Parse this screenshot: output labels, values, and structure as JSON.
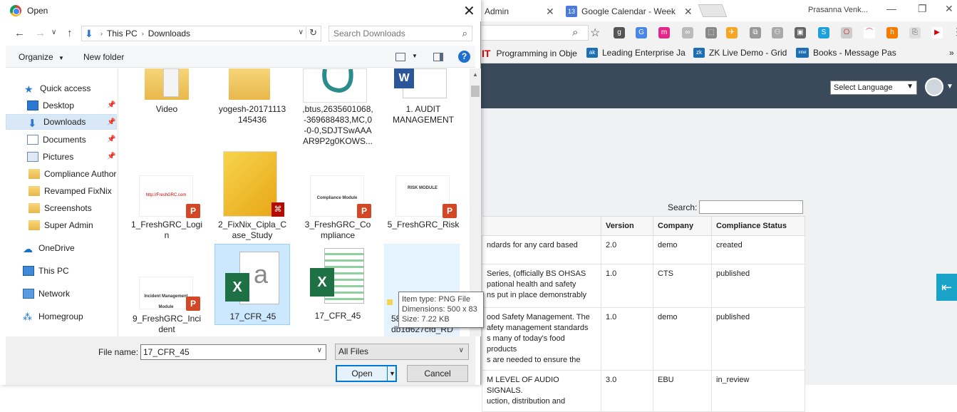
{
  "browser": {
    "tabs": [
      {
        "label": "Admin"
      },
      {
        "label": "Google Calendar - Week",
        "favicon_text": "13"
      }
    ],
    "profile_name": "Prasanna Venk...",
    "bookmarks": [
      {
        "label": "Programming in Obje",
        "prefix": "IT"
      },
      {
        "label": "Leading Enterprise Ja",
        "icon_text": "ak"
      },
      {
        "label": "ZK Live Demo - Grid",
        "icon_text": "zk"
      },
      {
        "label": "Books - Message Pas",
        "icon_text": "intel"
      }
    ],
    "language_select": "Select Language",
    "search_label": "Search:",
    "table": {
      "headers": [
        "Version",
        "Company",
        "Compliance Status"
      ],
      "rows": [
        {
          "desc": "ndards for any card based",
          "version": "2.0",
          "company": "demo",
          "status": "created"
        },
        {
          "desc": "Series, (officially BS OHSAS\npational health and safety\nns put in place demonstrably",
          "version": "1.0",
          "company": "CTS",
          "status": "published"
        },
        {
          "desc": "ood Safety Management. The\nafety management standards\ns many of today's food products\ns are needed to ensure the",
          "version": "1.0",
          "company": "demo",
          "status": "published"
        },
        {
          "desc": "M LEVEL OF AUDIO SIGNALS.\nuction, distribution and",
          "version": "3.0",
          "company": "EBU",
          "status": "in_review"
        }
      ]
    }
  },
  "dialog": {
    "title": "Open",
    "breadcrumb": [
      "This PC",
      "Downloads"
    ],
    "search_placeholder": "Search Downloads",
    "toolbar": {
      "organize": "Organize",
      "new_folder": "New folder",
      "help": "?"
    },
    "nav": [
      {
        "label": "Quick access",
        "icon": "star-icon"
      },
      {
        "label": "Desktop",
        "icon": "desktop-icon",
        "pinned": true
      },
      {
        "label": "Downloads",
        "icon": "download-icon",
        "pinned": true,
        "selected": true
      },
      {
        "label": "Documents",
        "icon": "documents-icon",
        "pinned": true
      },
      {
        "label": "Pictures",
        "icon": "pictures-icon",
        "pinned": true
      },
      {
        "label": "Compliance Author",
        "icon": "folder-icon"
      },
      {
        "label": "Revamped FixNix",
        "icon": "folder-icon"
      },
      {
        "label": "Screenshots",
        "icon": "folder-icon"
      },
      {
        "label": "Super Admin",
        "icon": "folder-icon"
      },
      {
        "label": "OneDrive",
        "icon": "cloud-icon"
      },
      {
        "label": "This PC",
        "icon": "computer-icon"
      },
      {
        "label": "Network",
        "icon": "network-icon"
      },
      {
        "label": "Homegroup",
        "icon": "homegroup-icon"
      }
    ],
    "files": [
      {
        "name": "Video"
      },
      {
        "name": "yogesh-20171113\n145436"
      },
      {
        "name": ",btus,2635601068,\n-369688483,MC,0\n-0-0,SDJTSwAAA\nAR9P2g0KOWS..."
      },
      {
        "name": "1. AUDIT\nMANAGEMENT",
        "badge": "W"
      },
      {
        "name": "1_FreshGRC_Logi\nn",
        "slide_text": "http://FreshGRC.com",
        "badge": "P"
      },
      {
        "name": "2_FixNix_Cipla_C\nase_Study",
        "badge": "PDF"
      },
      {
        "name": "3_FreshGRC_Co\nmpliance",
        "slide_text": "Compliance Module",
        "badge": "P"
      },
      {
        "name": "5_FreshGRC_Risk",
        "slide_text": "RISK MODULE",
        "badge": "P"
      },
      {
        "name": "9_FreshGRC_Inci\ndent",
        "slide_text": "Incident Management Module",
        "badge": "P"
      },
      {
        "name": "17_CFR_45",
        "badge": "X",
        "selected": true
      },
      {
        "name": "17_CFR_45",
        "badge": "X"
      },
      {
        "name": "58...\ndb1d627cfd_RD",
        "hover": true
      }
    ],
    "tooltip": {
      "line1": "Item type: PNG File",
      "line2": "Dimensions: 500 x 83",
      "line3": "Size: 7.22 KB"
    },
    "file_name_label": "File name:",
    "file_name_value": "17_CFR_45",
    "file_type": "All Files",
    "open_label": "Open",
    "cancel_label": "Cancel"
  },
  "colors": {
    "accent": "#0078d7",
    "appbar": "#3b4a5b",
    "excel": "#1e7145",
    "powerpoint": "#d24726"
  }
}
